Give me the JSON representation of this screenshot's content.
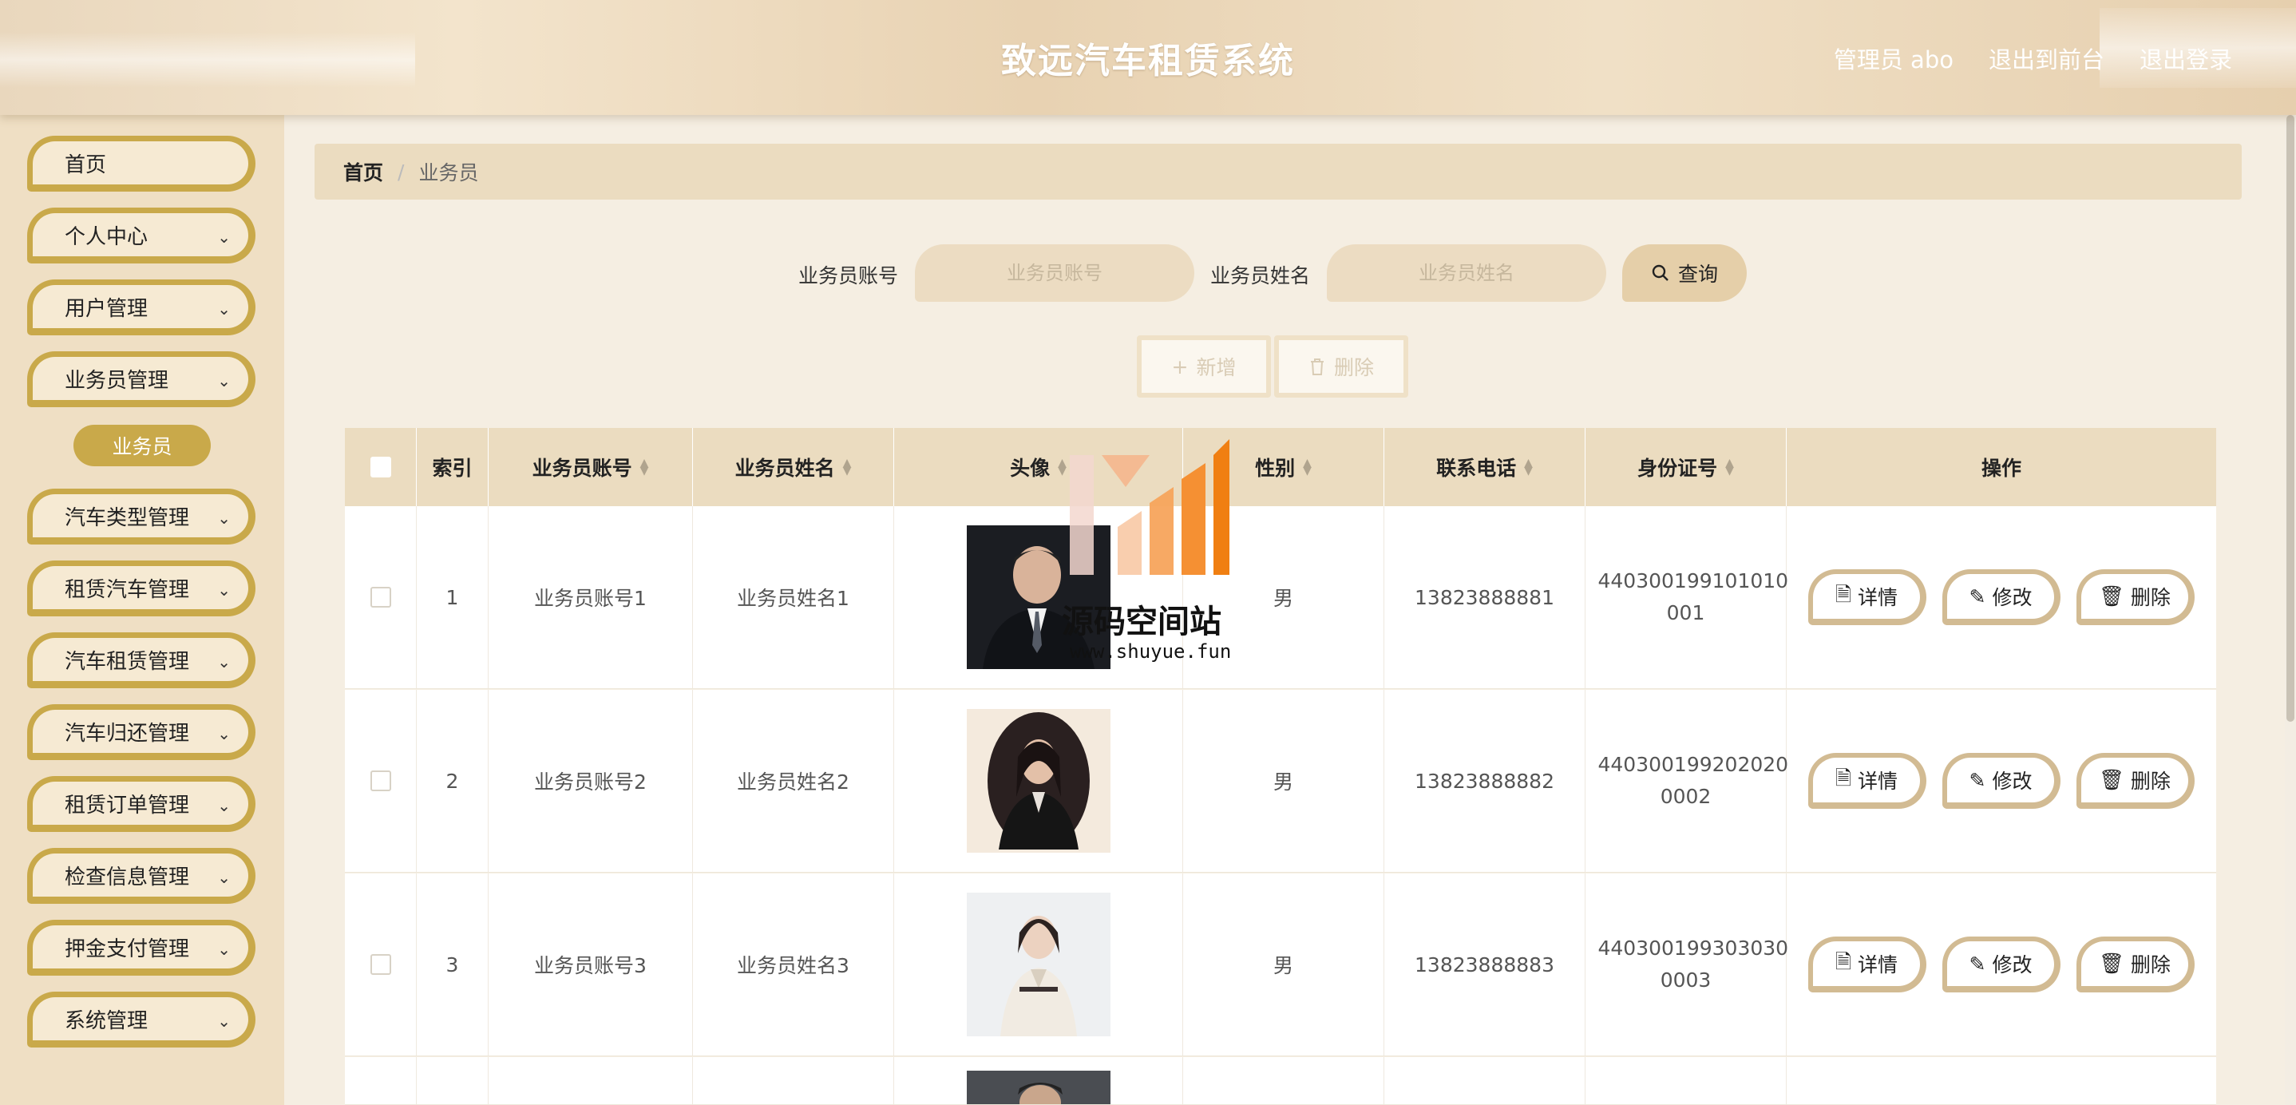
{
  "header": {
    "title": "致远汽车租赁系统",
    "user": "管理员 abo",
    "to_front": "退出到前台",
    "logout": "退出登录"
  },
  "sidebar": {
    "items": [
      {
        "label": "首页",
        "expandable": false
      },
      {
        "label": "个人中心",
        "expandable": true
      },
      {
        "label": "用户管理",
        "expandable": true
      },
      {
        "label": "业务员管理",
        "expandable": true
      },
      {
        "label": "汽车类型管理",
        "expandable": true
      },
      {
        "label": "租赁汽车管理",
        "expandable": true
      },
      {
        "label": "汽车租赁管理",
        "expandable": true
      },
      {
        "label": "汽车归还管理",
        "expandable": true
      },
      {
        "label": "租赁订单管理",
        "expandable": true
      },
      {
        "label": "检查信息管理",
        "expandable": true
      },
      {
        "label": "押金支付管理",
        "expandable": true
      },
      {
        "label": "系统管理",
        "expandable": true
      }
    ],
    "sub_item": "业务员"
  },
  "breadcrumb": {
    "home": "首页",
    "sep": "/",
    "current": "业务员"
  },
  "search": {
    "account_label": "业务员账号",
    "account_placeholder": "业务员账号",
    "name_label": "业务员姓名",
    "name_placeholder": "业务员姓名",
    "query_button": "查询"
  },
  "actions": {
    "add": "新增",
    "delete": "删除"
  },
  "table": {
    "columns": [
      "索引",
      "业务员账号",
      "业务员姓名",
      "头像",
      "性别",
      "联系电话",
      "身份证号",
      "操作"
    ],
    "rows": [
      {
        "index": "1",
        "account": "业务员账号1",
        "name": "业务员姓名1",
        "gender": "男",
        "phone": "13823888881",
        "id_line1": "440300199101010",
        "id_line2": "001"
      },
      {
        "index": "2",
        "account": "业务员账号2",
        "name": "业务员姓名2",
        "gender": "男",
        "phone": "13823888882",
        "id_line1": "440300199202020",
        "id_line2": "0002"
      },
      {
        "index": "3",
        "account": "业务员账号3",
        "name": "业务员姓名3",
        "gender": "男",
        "phone": "13823888883",
        "id_line1": "440300199303030",
        "id_line2": "0003"
      }
    ],
    "ops": {
      "detail": "详情",
      "edit": "修改",
      "delete": "删除"
    }
  },
  "watermark": {
    "text": "源码空间站",
    "url": "www.shuyue.fun"
  },
  "colors": {
    "accent": "#c9a94a",
    "header_bg": "#efdcc0",
    "table_header": "#ebdcc0",
    "sidebar_bg": "#efdfc4"
  }
}
